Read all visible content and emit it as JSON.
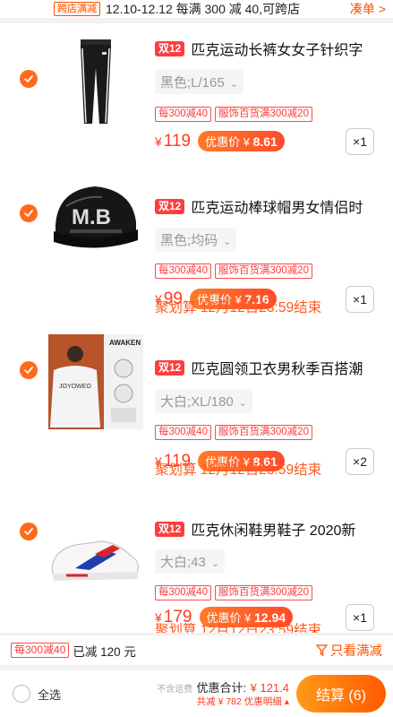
{
  "promo_bar": {
    "tag": "跨店满减",
    "text": "12.10-12.12 每满 300 减 40,可跨店",
    "link": "凑单 >"
  },
  "items": [
    {
      "badge": "双12",
      "title": "匹克运动长裤女女子针织字",
      "sku": "黑色;L/165",
      "promo_tags": [
        "每300减40",
        "服饰百货满300减20"
      ],
      "currency": "¥",
      "price": "119",
      "discount_label": "优惠价",
      "discount_currency": "¥",
      "discount_price": "8.61",
      "qty": "×1",
      "juhuasuan": "",
      "checked": true,
      "image": "black-track-pants"
    },
    {
      "badge": "双12",
      "title": "匹克运动棒球帽男女情侣时",
      "sku": "黑色;均码",
      "promo_tags": [
        "每300减40",
        "服饰百货满300减20"
      ],
      "currency": "¥",
      "price": "99",
      "discount_label": "优惠价",
      "discount_currency": "¥",
      "discount_price": "7.16",
      "qty": "×1",
      "juhuasuan": "聚划算 12月12日23:59结束",
      "checked": true,
      "image": "black-baseball-cap-mb"
    },
    {
      "badge": "双12",
      "title": "匹克圆领卫衣男秋季百搭潮",
      "sku": "大白;XL/180",
      "promo_tags": [
        "每300减40",
        "服饰百货满300减20"
      ],
      "currency": "¥",
      "price": "119",
      "discount_label": "优惠价",
      "discount_currency": "¥",
      "discount_price": "8.61",
      "qty": "×2",
      "juhuasuan": "聚划算 12月12日23:59结束",
      "checked": true,
      "image": "white-crewneck-sweatshirt",
      "image_text": "AWAKEN"
    },
    {
      "badge": "双12",
      "title": "匹克休闲鞋男鞋子 2020新",
      "sku": "大白;43",
      "promo_tags": [
        "每300减40",
        "服饰百货满300减20"
      ],
      "currency": "¥",
      "price": "179",
      "discount_label": "优惠价",
      "discount_currency": "¥",
      "discount_price": "12.94",
      "qty": "×1",
      "juhuasuan": "聚划算 12月12日23:59结束",
      "checked": true,
      "image": "white-red-blue-sneaker"
    }
  ],
  "summary": {
    "tag": "每300减40",
    "text": "已减 120 元",
    "filter_label": "只看满减"
  },
  "checkout": {
    "select_all": "全选",
    "no_shipping": "不含运费",
    "total_label": "优惠合计:",
    "total_value": "¥ 121.4",
    "saved_text": "共减 ¥ 782",
    "detail_link": "优惠明细 ▴",
    "settle_label": "结算 (6)"
  },
  "colors": {
    "accent": "#ff5000",
    "price_red": "#ff3b1f",
    "check_orange": "#ff6a1a"
  }
}
